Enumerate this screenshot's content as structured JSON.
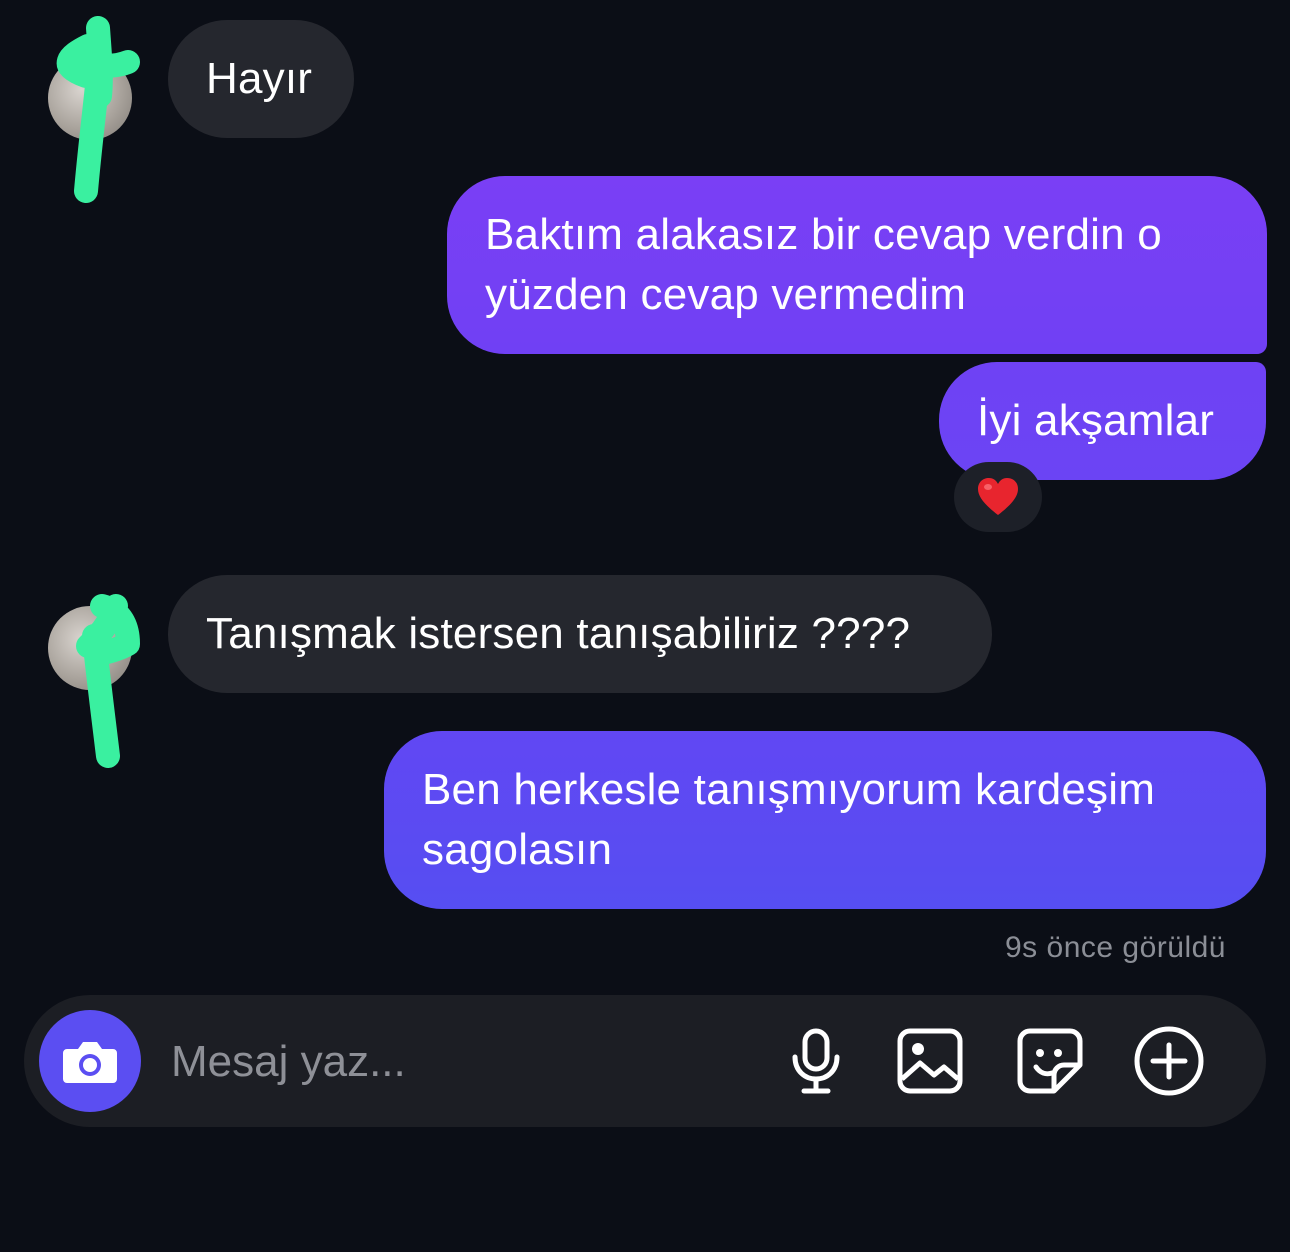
{
  "messages": [
    {
      "direction": "incoming",
      "text": "Hayır"
    },
    {
      "direction": "outgoing",
      "text": "Baktım alakasız bir cevap verdin o yüzden cevap vermedim"
    },
    {
      "direction": "outgoing",
      "text": "İyi akşamlar",
      "reaction": "❤️"
    },
    {
      "direction": "incoming",
      "text": "Tanışmak istersen tanışabiliriz ????"
    },
    {
      "direction": "outgoing",
      "text": "Ben herkesle tanışmıyorum kardeşim sagolasın"
    }
  ],
  "seen_status": "9s önce görüldü",
  "composer": {
    "placeholder": "Mesaj yaz...",
    "camera_icon": "camera-icon",
    "tools": [
      "microphone-icon",
      "gallery-icon",
      "sticker-icon",
      "plus-circle-icon"
    ]
  },
  "colors": {
    "background": "#0b0e16",
    "incoming_bubble": "#25272e",
    "outgoing_gradient_top": "#7a3ff5",
    "outgoing_gradient_bottom": "#5a4cf2",
    "camera_button": "#5b4ef2",
    "avatar_scribble": "#3af0a0"
  }
}
